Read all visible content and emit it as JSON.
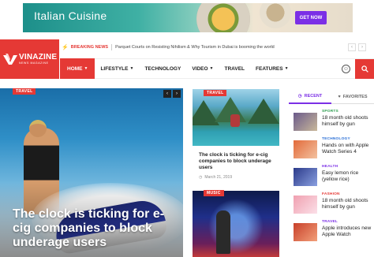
{
  "ad": {
    "title": "Italian Cuisine",
    "button": "GET NOW"
  },
  "breaking": {
    "label": "BREAKING NEWS",
    "headline": "Parquet Courts on Resisting Nihilism & Why Tourism in Dubai is booming the world"
  },
  "logo": {
    "name": "VINAZINE",
    "subtitle": "NEWS MAGAZINE"
  },
  "nav": {
    "items": [
      {
        "label": "HOME",
        "caret": true
      },
      {
        "label": "LIFESTYLE",
        "caret": true
      },
      {
        "label": "TECHNOLOGY",
        "caret": false
      },
      {
        "label": "VIDEO",
        "caret": true
      },
      {
        "label": "TRAVEL",
        "caret": false
      },
      {
        "label": "FEATURES",
        "caret": true
      }
    ]
  },
  "hero": {
    "tag": "TRAVEL",
    "title": "The clock is ticking for e-cig companies to block underage users"
  },
  "cards": [
    {
      "tag": "TRAVEL",
      "title": "The clock is ticking for e-cig companies to block underage users",
      "date": "March 21, 2019"
    },
    {
      "tag": "MUSIC"
    }
  ],
  "sidebar": {
    "tabs": [
      "RECENT",
      "FAVORITES"
    ],
    "items": [
      {
        "category": "SPORTS",
        "cat_color": "#2e9e4f",
        "title": "18 month old shoots himself by gun",
        "thumb": "linear-gradient(135deg,#6a5a8a,#c9b89a)"
      },
      {
        "category": "TECHNOLOGY",
        "cat_color": "#2a6fd6",
        "title": "Hands on with Apple Watch Series 4",
        "thumb": "linear-gradient(135deg,#e26a3a,#f3c2a0)"
      },
      {
        "category": "HEALTH",
        "cat_color": "#7b2fe6",
        "title": "Easy lemon rice (yellow rice)",
        "thumb": "linear-gradient(135deg,#2b3a8a,#8aa0e0)"
      },
      {
        "category": "FASHION",
        "cat_color": "#e53935",
        "title": "18 month old shoots himself by gun",
        "thumb": "linear-gradient(135deg,#f0a0b0,#fbe0e8)"
      },
      {
        "category": "TRAVEL",
        "cat_color": "#7b2fe6",
        "title": "Apple introduces new Apple Watch",
        "thumb": "linear-gradient(135deg,#c8402a,#f2a07a)"
      }
    ]
  }
}
